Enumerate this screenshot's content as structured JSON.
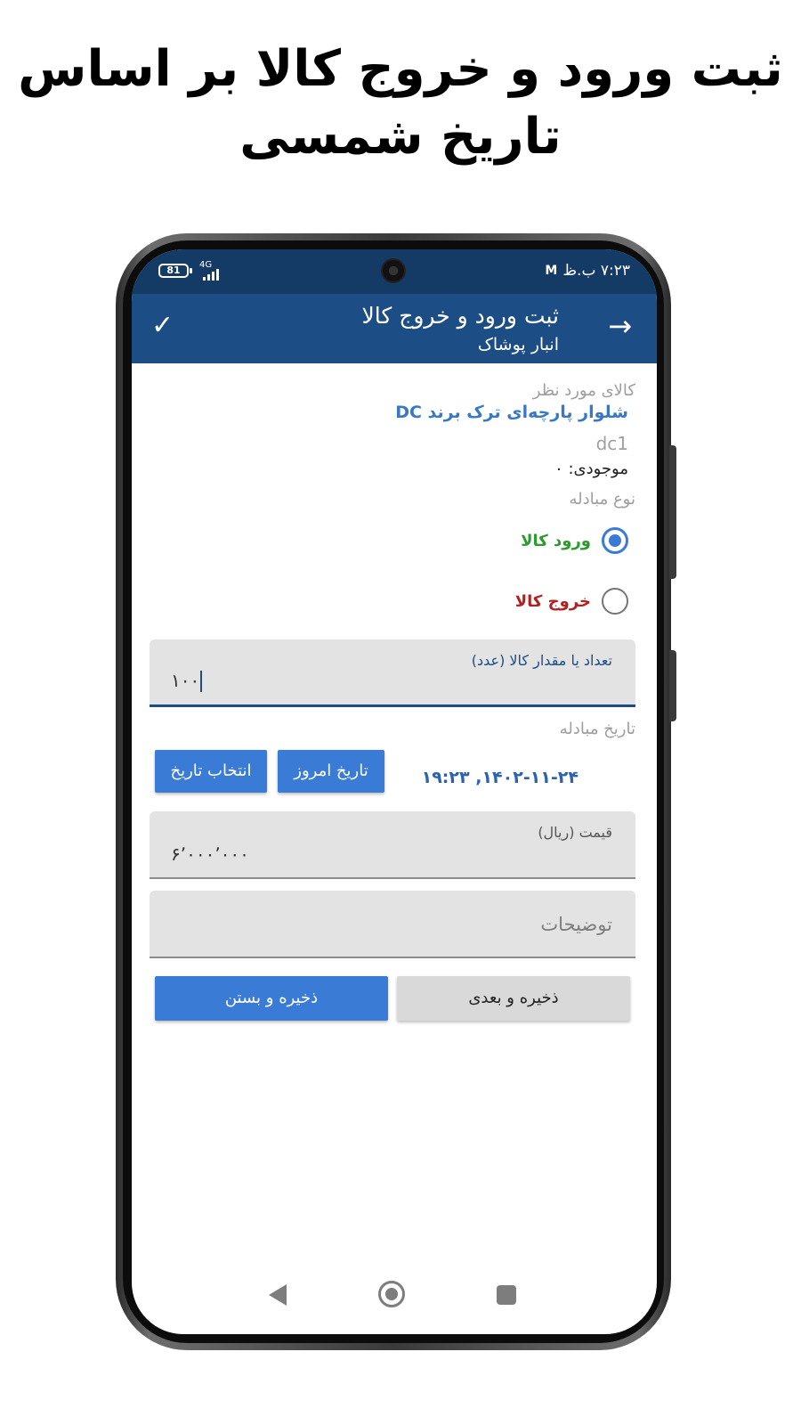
{
  "promo": {
    "title_line1": "ثبت ورود و خروج کالا بر اساس",
    "title_line2": "تاریخ شمسی"
  },
  "status_bar": {
    "battery": "81",
    "network": "4G",
    "time": "۷:۲۳ ب.ظ",
    "icons": [
      "battery-icon",
      "signal-icon",
      "mail-icon"
    ]
  },
  "app_bar": {
    "title": "ثبت ورود و خروج کالا",
    "subtitle": "انبار پوشاک",
    "back_icon": "→",
    "confirm_icon": "✓"
  },
  "product": {
    "section_label": "کالای مورد نظر",
    "name": "شلوار پارچه‌ای ترک برند DC",
    "code": "dc1",
    "stock": "موجودی: ۰"
  },
  "transaction_type": {
    "label": "نوع مبادله",
    "options": [
      {
        "label": "ورود کالا",
        "checked": true,
        "color": "#2e9a2e"
      },
      {
        "label": "خروج کالا",
        "checked": false,
        "color": "#b32020"
      }
    ]
  },
  "quantity": {
    "label": "تعداد یا مقدار کالا (عدد)",
    "value": "۱۰۰"
  },
  "date": {
    "label": "تاریخ مبادله",
    "value": "۱۴۰۲-۱۱-۲۴, ۱۹:۲۳",
    "today_button": "تاریخ امروز",
    "pick_button": "انتخاب تاریخ"
  },
  "price": {
    "label": "قیمت (ریال)",
    "value": "۶٬۰۰۰٬۰۰۰"
  },
  "notes": {
    "placeholder": "توضیحات"
  },
  "actions": {
    "save_next": "ذخیره و بعدی",
    "save_close": "ذخیره و بستن"
  },
  "colors": {
    "app_bar": "#1d4d85",
    "status_bar": "#143a66",
    "accent": "#3a7bd5"
  }
}
